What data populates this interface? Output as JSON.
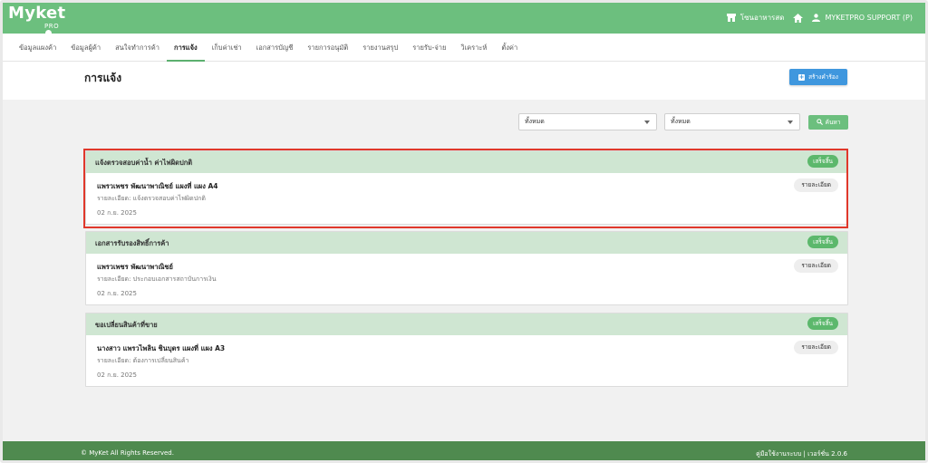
{
  "app": {
    "logo_text": "Myket",
    "logo_sub": "PRO"
  },
  "header": {
    "shop_label": "โซนอาหารสด",
    "user_label": "MYKETPRO SUPPORT (P)",
    "icons": [
      "store-icon",
      "home-icon",
      "user-icon"
    ]
  },
  "nav": {
    "tabs": [
      {
        "label": "ข้อมูลแผงค้า",
        "active": false
      },
      {
        "label": "ข้อมูลผู้ค้า",
        "active": false
      },
      {
        "label": "สนใจทำการค้า",
        "active": false
      },
      {
        "label": "การแจ้ง",
        "active": true
      },
      {
        "label": "เก็บค่าเช่า",
        "active": false
      },
      {
        "label": "เอกสารบัญชี",
        "active": false
      },
      {
        "label": "รายการอนุมัติ",
        "active": false
      },
      {
        "label": "รายงานสรุป",
        "active": false
      },
      {
        "label": "รายรับ-จ่าย",
        "active": false
      },
      {
        "label": "วิเคราะห์",
        "active": false
      },
      {
        "label": "ตั้งค่า",
        "active": false
      }
    ]
  },
  "page": {
    "title": "การแจ้ง",
    "create_button": "สร้างคำร้อง"
  },
  "filters": {
    "filter1": "ทั้งหมด",
    "filter2": "ทั้งหมด",
    "search_button": "ค้นหา"
  },
  "cards": [
    {
      "title": "แจ้งตรวจสอบค่าน้ำ ค่าไฟผิดปกติ",
      "status": "เสร็จสิ้น",
      "name": "แพรวเพชร พัฒนาพาณิชย์ แผงที่ แผง A4",
      "detail": "รายละเอียด: แจ้งตรวจสอบค่าไฟผิดปกติ",
      "date": "02 ก.ย. 2025",
      "detail_button": "รายละเอียด"
    },
    {
      "title": "เอกสารรับรองสิทธิ์การค้า",
      "status": "เสร็จสิ้น",
      "name": "แพรวเพชร พัฒนาพาณิชย์",
      "detail": "รายละเอียด: ประกอบเอกสารสถาบันการเงิน",
      "date": "02 ก.ย. 2025",
      "detail_button": "รายละเอียด"
    },
    {
      "title": "ขอเปลี่ยนสินค้าที่ขาย",
      "status": "เสร็จสิ้น",
      "name": "นางสาว แพรวไพลิน ชินบุตร แผงที่ แผง A3",
      "detail": "รายละเอียด: ต้องการเปลี่ยนสินค้า",
      "date": "02 ก.ย. 2025",
      "detail_button": "รายละเอียด"
    }
  ],
  "footer": {
    "copyright": "© MyKet All Rights Reserved.",
    "links": "คู่มือใช้งานระบบ | เวอร์ชั่น 2.0.6"
  },
  "colors": {
    "header_green": "#6cbf7e",
    "footer_green": "#4f8a4f",
    "card_head": "#cfe6d2",
    "badge": "#5cb86c",
    "primary_blue": "#3f97de",
    "highlight_red": "#e0382b"
  }
}
